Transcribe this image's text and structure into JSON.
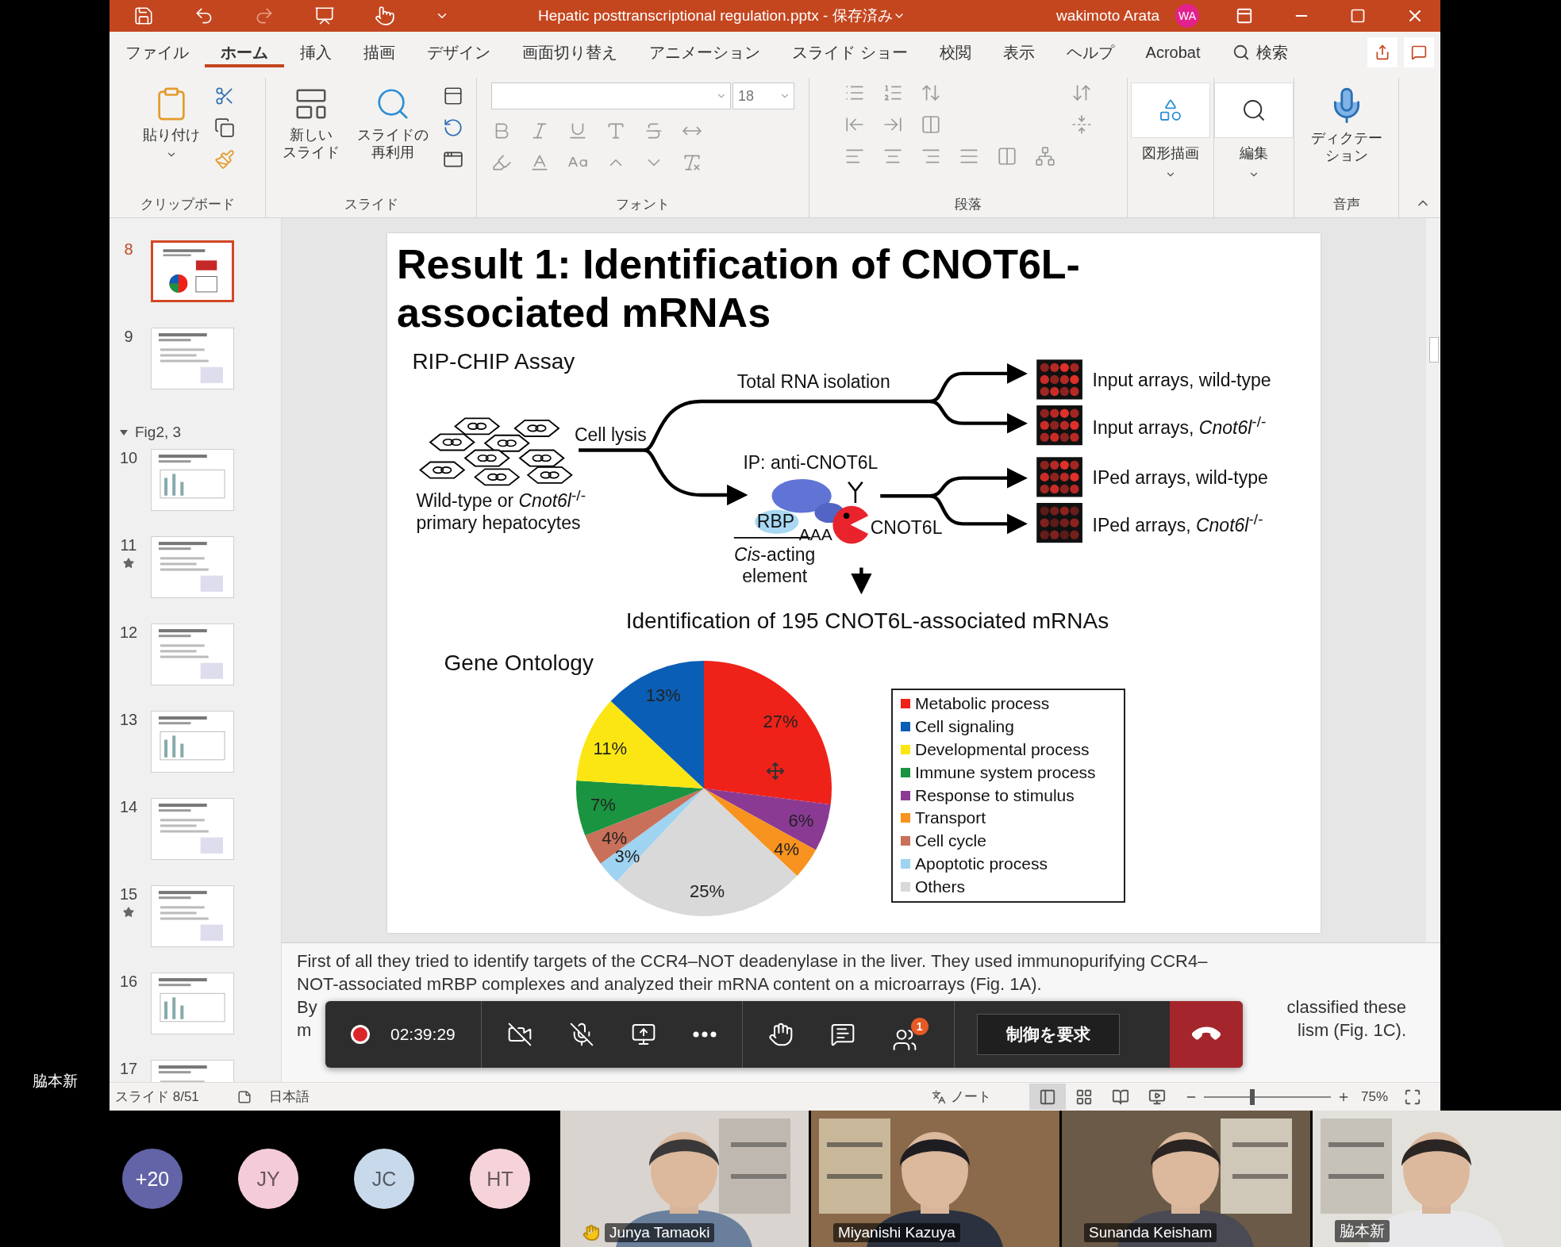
{
  "self_label": "脇本新",
  "title_bar": {
    "title": "Hepatic posttranscriptional regulation.pptx - 保存済み",
    "user": "wakimoto Arata",
    "avatar": "WA"
  },
  "tabs": [
    {
      "label": "ファイル",
      "selected": false
    },
    {
      "label": "ホーム",
      "selected": true
    },
    {
      "label": "挿入",
      "selected": false
    },
    {
      "label": "描画",
      "selected": false
    },
    {
      "label": "デザイン",
      "selected": false
    },
    {
      "label": "画面切り替え",
      "selected": false
    },
    {
      "label": "アニメーション",
      "selected": false
    },
    {
      "label": "スライド ショー",
      "selected": false
    },
    {
      "label": "校閲",
      "selected": false
    },
    {
      "label": "表示",
      "selected": false
    },
    {
      "label": "ヘルプ",
      "selected": false
    },
    {
      "label": "Acrobat",
      "selected": false
    }
  ],
  "search": "検索",
  "ribbon": [
    {
      "kind": "clipboard",
      "label": "クリップボード",
      "paste": "貼り付け"
    },
    {
      "kind": "slides",
      "label": "スライド",
      "new_slide": [
        "新しい",
        "スライド"
      ],
      "reuse": [
        "スライドの",
        "再利用"
      ]
    },
    {
      "kind": "font",
      "label": "フォント",
      "font_size": "18"
    },
    {
      "kind": "paragraph",
      "label": "段落"
    },
    {
      "kind": "command",
      "button": [
        "図形描画"
      ]
    },
    {
      "kind": "command",
      "button": [
        "編集"
      ]
    },
    {
      "kind": "voice",
      "label": "音声",
      "button": [
        "ディクテー",
        "ション"
      ]
    }
  ],
  "slides_panel": [
    {
      "kind": "slide",
      "number": "8",
      "selected": true,
      "starred": false
    },
    {
      "kind": "slide",
      "number": "9",
      "selected": false,
      "starred": false
    },
    {
      "kind": "section",
      "label": "Fig2, 3",
      "expanded": true
    },
    {
      "kind": "slide",
      "number": "10",
      "selected": false,
      "starred": false
    },
    {
      "kind": "slide",
      "number": "11",
      "selected": false,
      "starred": true
    },
    {
      "kind": "slide",
      "number": "12",
      "selected": false,
      "starred": false
    },
    {
      "kind": "slide",
      "number": "13",
      "selected": false,
      "starred": false
    },
    {
      "kind": "slide",
      "number": "14",
      "selected": false,
      "starred": false
    },
    {
      "kind": "slide",
      "number": "15",
      "selected": false,
      "starred": true
    },
    {
      "kind": "slide",
      "number": "16",
      "selected": false,
      "starred": false
    },
    {
      "kind": "slide",
      "number": "17",
      "selected": false,
      "starred": false
    }
  ],
  "slide": {
    "title": "Result 1: Identification of CNOT6L-associated mRNAs",
    "diagram": {
      "assay_title": "RIP-CHIP Assay",
      "cell_lysis": "Cell lysis",
      "cells_caption": [
        "Wild-type or *Cnot6l*$^{-/-}$",
        "primary hepatocytes"
      ],
      "total_rna": "Total RNA isolation",
      "ip": "IP: anti-CNOT6L",
      "rbp": "RBP",
      "aaa": "AAA",
      "cnot6l": "CNOT6L",
      "cis_element": [
        "*Cis*-acting",
        "element"
      ],
      "arrays": [
        {
          "label": "Input arrays, wild-type"
        },
        {
          "label": "Input arrays, *Cnot6l*$^{-/-}$"
        },
        {
          "label": "IPed arrays, wild-type"
        },
        {
          "label": "IPed arrays, *Cnot6l*$^{-/-}$"
        }
      ],
      "result": "Identification of 195 CNOT6L-associated mRNAs"
    },
    "chart": {
      "chart_data": {
        "type": "pie",
        "title": "Gene Ontology",
        "values": [
          27,
          6,
          4,
          25,
          3,
          4,
          7,
          11,
          13
        ],
        "colors": [
          "#ef2219",
          "#8b3a94",
          "#f7931e",
          "#d9d9d9",
          "#9fd3f2",
          "#c8705a",
          "#1a9440",
          "#fbe614",
          "#0b5eb5"
        ],
        "value_labels": [
          "27%",
          "6%",
          "4%",
          "25%",
          "3%",
          "4%",
          "7%",
          "11%",
          "13%"
        ]
      },
      "legend": [
        {
          "label": "Metabolic process",
          "color": "#ef2219"
        },
        {
          "label": "Cell signaling",
          "color": "#0b5eb5"
        },
        {
          "label": "Developmental process",
          "color": "#fbe614"
        },
        {
          "label": "Immune system process",
          "color": "#1a9440"
        },
        {
          "label": "Response to stimulus",
          "color": "#8b3a94"
        },
        {
          "label": "Transport",
          "color": "#f7931e"
        },
        {
          "label": "Cell cycle",
          "color": "#c8705a"
        },
        {
          "label": "Apoptotic process",
          "color": "#9fd3f2"
        },
        {
          "label": "Others",
          "color": "#d9d9d9"
        }
      ]
    }
  },
  "notes": {
    "lines": [
      "First of all they tried to identify targets of the CCR4–NOT deadenylase in the liver. They used immunopurifying CCR4–",
      "NOT-associated mRBP complexes and analyzed their mRNA content on a microarrays (Fig. 1A)."
    ],
    "partial_lines": [
      {
        "left": "By",
        "right": "classified these"
      },
      {
        "left": "m",
        "right": "lism (Fig. 1C)."
      }
    ]
  },
  "meeting_toolbar": {
    "recording": true,
    "timer": "02:39:29",
    "participants_badge": "1",
    "request_control": "制御を要求"
  },
  "status_bar": {
    "slide": "スライド 8/51",
    "language": "日本語",
    "notes": "ノート",
    "zoom": {
      "level": 0.38
    },
    "zoom_text": "75%"
  },
  "participants": [
    {
      "initials": "+20",
      "color": "#6264a7"
    },
    {
      "initials": "JY",
      "color": "#f3cbd9"
    },
    {
      "initials": "JC",
      "color": "#c9d9ec"
    },
    {
      "initials": "HT",
      "color": "#f5d3d9"
    }
  ],
  "videos": [
    {
      "name": "Junya Tamaoki",
      "hand_raised": true
    },
    {
      "name": "Miyanishi Kazuya",
      "hand_raised": false
    },
    {
      "name": "Sunanda Keisham",
      "hand_raised": false
    },
    {
      "name": "脇本新",
      "hand_raised": false
    }
  ]
}
